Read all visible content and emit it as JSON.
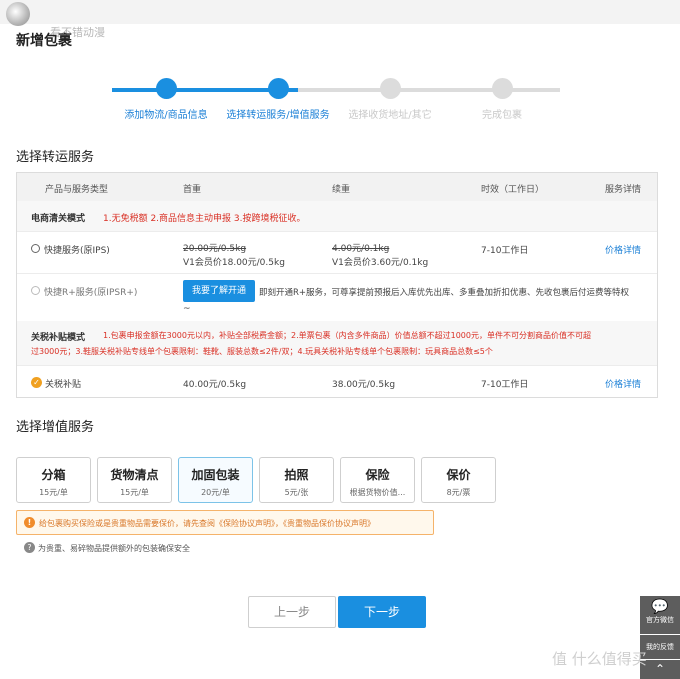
{
  "header": {
    "title": "新增包裹",
    "watermark": "看不错动漫"
  },
  "steps": [
    {
      "label": "添加物流/商品信息",
      "state": "done"
    },
    {
      "label": "选择转运服务/增值服务",
      "state": "active"
    },
    {
      "label": "选择收货地址/其它",
      "state": "pending"
    },
    {
      "label": "完成包裹",
      "state": "pending"
    }
  ],
  "transport": {
    "section_title": "选择转运服务",
    "columns": [
      "产品与服务类型",
      "首重",
      "续重",
      "时效（工作日）",
      "服务详情"
    ],
    "mode1": {
      "name": "电商清关模式",
      "desc": "1.无免税额 2.商品信息主动申报 3.按跨境税征收。",
      "rows": [
        {
          "name": "快捷服务(原IPS)",
          "first_price": "20.00元/0.5kg",
          "first_vip": "V1会员价18.00元/0.5kg",
          "cont_price": "4.00元/0.1kg",
          "cont_vip": "V1会员价3.60元/0.1kg",
          "time": "7-10工作日",
          "detail": "价格详情"
        },
        {
          "name": "快捷R+服务(原IPSR+)",
          "button": "我要了解开通",
          "desc": "即刻开通R+服务，可尊享提前预报后入库优先出库、多重叠加折扣优惠、先收包裹后付运费等特权",
          "tail": "~"
        }
      ]
    },
    "mode2": {
      "name": "关税补贴模式",
      "desc_line1": "1.包裹申报金额在3000元以内，补贴全部税费金额；2.单票包裹（内含多件商品）价值总额不超过1000元，单件不可分割商品价值不可超",
      "desc_line2": "过3000元；3.鞋服关税补贴专线单个包裹限制：鞋靴、服装总数≤2件/双；4.玩具关税补贴专线单个包裹限制：玩具商品总数≤5个",
      "row": {
        "name": "关税补贴",
        "check": "✓",
        "first": "40.00元/0.5kg",
        "cont": "38.00元/0.5kg",
        "time": "7-10工作日",
        "detail": "价格详情"
      }
    }
  },
  "value_added": {
    "section_title": "选择增值服务",
    "cards": [
      {
        "name": "分箱",
        "price": "15元/单",
        "selected": false
      },
      {
        "name": "货物清点",
        "price": "15元/单",
        "selected": false
      },
      {
        "name": "加固包装",
        "price": "20元/单",
        "selected": true
      },
      {
        "name": "拍照",
        "price": "5元/张",
        "selected": false
      },
      {
        "name": "保险",
        "price": "根据货物价值...",
        "selected": false
      },
      {
        "name": "保价",
        "price": "8元/票",
        "selected": false
      }
    ],
    "notice": "给包裹购买保险或是贵重物品需要保价，请先查阅《保险协议声明》，《贵重物品保价协议声明》",
    "notice_icon": "!",
    "tip": "为贵重、易碎物品提供额外的包装确保安全",
    "tip_icon": "?"
  },
  "buttons": {
    "prev": "上一步",
    "next": "下一步"
  },
  "side": {
    "wechat": "官方微信",
    "wechat_icon": "💬",
    "feedback": "我的反馈",
    "top_icon": "⌃"
  },
  "bottom_mark": "值 什么值得买",
  "colors": {
    "primary": "#1a8fe0",
    "danger": "#d93025",
    "warning": "#f08c2c",
    "check": "#f0a020"
  }
}
